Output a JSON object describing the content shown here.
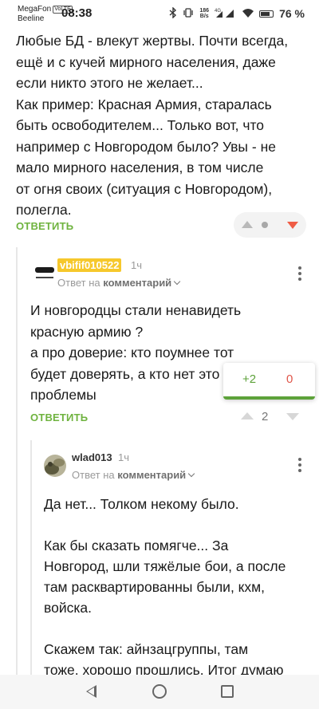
{
  "status_bar": {
    "carrier_1": "MegaFon",
    "volte": "VoLTE",
    "carrier_2": "Beeline",
    "time": "08:38",
    "speed_value": "186",
    "speed_unit": "B/s",
    "network": "4G",
    "battery": "76 %"
  },
  "main_comment": {
    "lines": [
      "Любые БД - влекут жертвы. Почти всегда,",
      "ещё и с кучей мирного населения, даже",
      "если никто этого не желает...",
      "Как пример: Красная Армия, старалась",
      "быть освободителем... Только вот, что",
      "например с Новгородом было? Увы - не",
      "мало мирного населения, в том числе",
      "от огня своих (ситуация с Новгородом),",
      "полегла."
    ],
    "reply_label": "ОТВЕТИТЬ"
  },
  "reply_1": {
    "username": "vbifif010522",
    "time": "1ч",
    "meta_prefix": "Ответ на",
    "meta_link": "комментарий",
    "lines": [
      "И новгородцы стали ненавидеть",
      "красную армию ?",
      "а про доверие: кто поумнее тот",
      "будет доверять, а кто нет это",
      "проблемы"
    ],
    "reply_label": "ОТВЕТИТЬ",
    "score": "2",
    "popup": {
      "plus": "+2",
      "minus": "0",
      "positive_share": 1.0
    }
  },
  "reply_2": {
    "username": "wlad013",
    "time": "1ч",
    "meta_prefix": "Ответ на",
    "meta_link": "комментарий",
    "lines": [
      "Да нет... Толком некому было.",
      "",
      "Как бы сказать помягче... За",
      "Новгород, шли тяжёлые бои, а после",
      "там расквартированны были, кхм,",
      "войска.",
      "",
      "Скажем так: айнзацгруппы, там",
      "тоже, хорошо прошлись. Итог думаю"
    ]
  },
  "colors": {
    "accent_green": "#6fb33f",
    "downvote_red": "#ef5c45",
    "badge_yellow": "#f6c82c"
  },
  "icons": [
    "bluetooth-icon",
    "vibrate-icon",
    "wifi-icon",
    "signal-icon",
    "battery-icon",
    "back-icon",
    "home-icon",
    "recents-icon",
    "more-icon",
    "upvote-icon",
    "downvote-icon"
  ]
}
